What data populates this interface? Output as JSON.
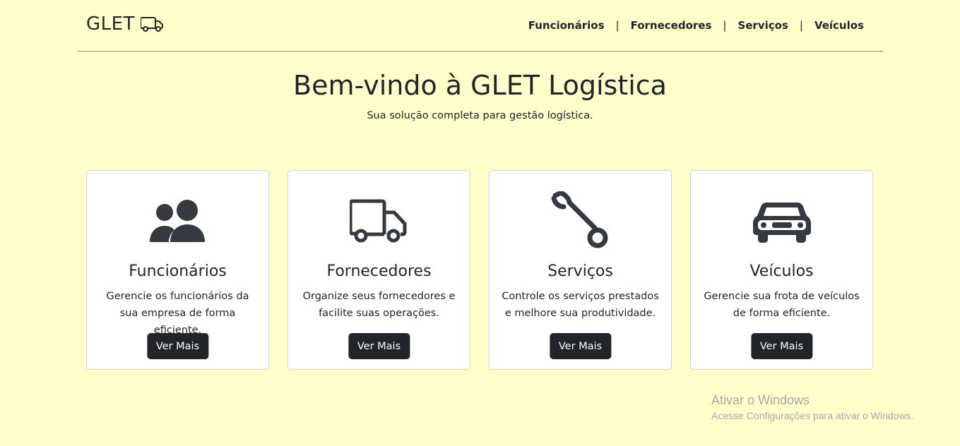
{
  "brand": {
    "name": "GLET",
    "icon": "truck-icon"
  },
  "nav": {
    "items": [
      "Funcionários",
      "Fornecedores",
      "Serviços",
      "Veículos"
    ],
    "separator": "|"
  },
  "hero": {
    "title": "Bem-vindo à GLET Logística",
    "subtitle": "Sua solução completa para gestão logística."
  },
  "cards": [
    {
      "icon": "people-icon",
      "title": "Funcionários",
      "text": "Gerencie os funcionários da sua empresa de forma eficiente.",
      "button": "Ver Mais"
    },
    {
      "icon": "truck-icon",
      "title": "Fornecedores",
      "text": "Organize seus fornecedores e facilite suas operações.",
      "button": "Ver Mais"
    },
    {
      "icon": "wrench-icon",
      "title": "Serviços",
      "text": "Controle os serviços prestados e melhore sua produtividade.",
      "button": "Ver Mais"
    },
    {
      "icon": "car-icon",
      "title": "Veículos",
      "text": "Gerencie sua frota de veículos de forma eficiente.",
      "button": "Ver Mais"
    }
  ],
  "watermark": {
    "line1": "Ativar o Windows",
    "line2": "Acesse Configurações para ativar o Windows."
  },
  "colors": {
    "background": "#ffffcc",
    "text": "#212529",
    "button": "#212529",
    "card": "#ffffff"
  }
}
